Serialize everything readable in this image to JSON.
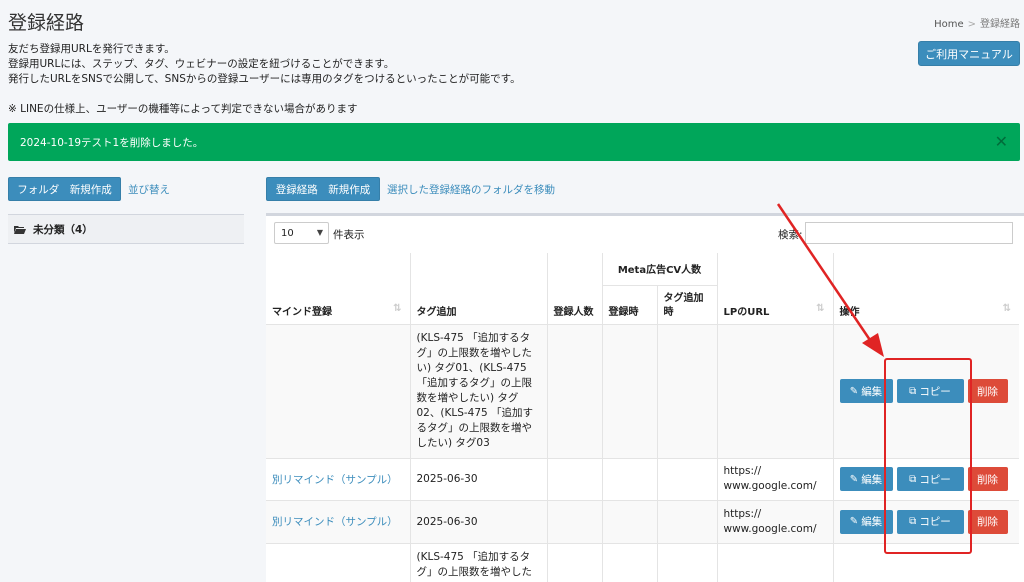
{
  "page": {
    "title": "登録経路",
    "breadcrumb": {
      "home": "Home",
      "sep": ">",
      "current": "登録経路"
    },
    "description": [
      "友だち登録用URLを発行できます。",
      "登録用URLには、ステップ、タグ、ウェビナーの設定を紐づけることができます。",
      "発行したURLをSNSで公開して、SNSからの登録ユーザーには専用のタグをつけるといったことが可能です。"
    ],
    "note": "※ LINEの仕様上、ユーザーの機種等によって判定できない場合があります",
    "manual_button": "ご利用マニュアル"
  },
  "alert": {
    "message": "2024-10-19テスト1を削除しました。",
    "close": "✕"
  },
  "folder": {
    "new_button": "フォルダ　新規作成",
    "sort_link": "並び替え",
    "items": [
      {
        "label": "未分類（4）"
      }
    ]
  },
  "routes": {
    "new_button": "登録経路　新規作成",
    "move_link": "選択した登録経路のフォルダを移動"
  },
  "table_controls": {
    "length_value": "10",
    "length_label": "件表示",
    "search_label": "検索:"
  },
  "columns": {
    "remind": "マインド登録",
    "tag_add": "タグ追加",
    "reg_count": "登録人数",
    "meta_group": "Meta広告CV人数",
    "reg_time": "登録時",
    "tag_time": "タグ追加時",
    "lp_url": "LPのURL",
    "ops": "操作"
  },
  "rows": [
    {
      "remind": "",
      "tag": "(KLS-475 「追加するタグ」の上限数を増やしたい) タグ01、(KLS-475 「追加するタグ」の上限数を増やしたい) タグ02、(KLS-475 「追加するタグ」の上限数を増やしたい) タグ03",
      "reg": "",
      "reg_time": "",
      "tag_time": "",
      "lp": ""
    },
    {
      "remind": "別リマインド（サンプル）",
      "tag": "2025-06-30",
      "reg": "",
      "reg_time": "",
      "tag_time": "",
      "lp": "https:// www.google.com/"
    },
    {
      "remind": "別リマインド（サンプル）",
      "tag": "2025-06-30",
      "reg": "",
      "reg_time": "",
      "tag_time": "",
      "lp": "https:// www.google.com/"
    },
    {
      "remind": "",
      "tag": "(KLS-475 「追加するタグ」の上限数を増やした",
      "reg": "",
      "reg_time": "",
      "tag_time": "",
      "lp": ""
    }
  ],
  "row_buttons": {
    "edit": "編集",
    "copy": "コピー",
    "delete": "削除"
  },
  "colors": {
    "primary": "#3c8dbc",
    "success": "#00a65a",
    "danger": "#dd4b39",
    "highlight": "#e02424"
  }
}
